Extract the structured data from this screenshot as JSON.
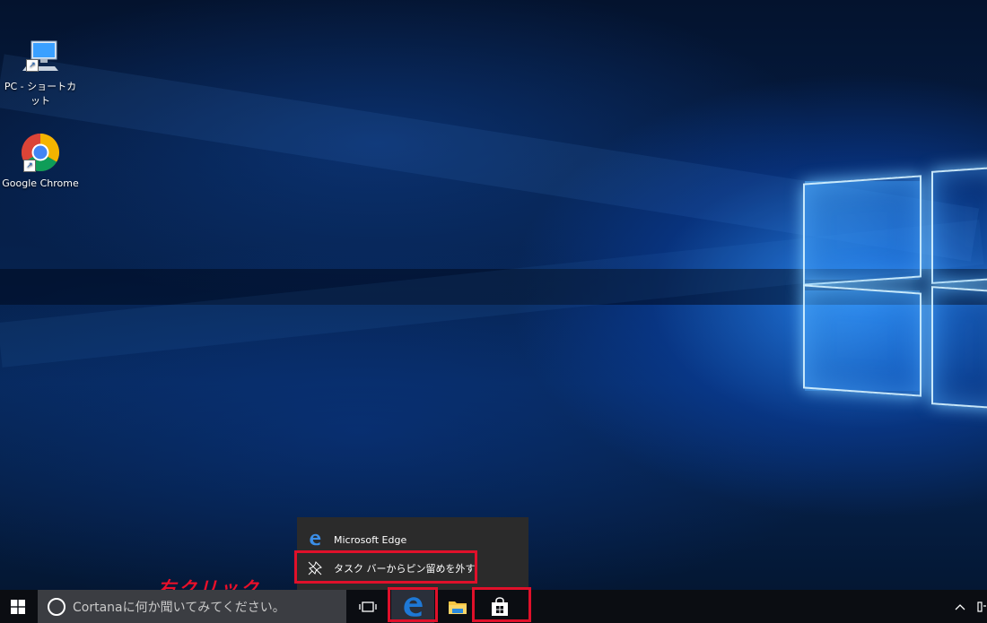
{
  "desktop": {
    "icons": [
      {
        "label": "PC - ショートカット",
        "icon": "pc-icon"
      },
      {
        "label": "Google Chrome",
        "icon": "chrome-icon"
      }
    ]
  },
  "jumplist": {
    "app_title": "Microsoft Edge",
    "unpin_label": "タスク バーからピン留めを外す"
  },
  "annotation": {
    "text": "右クリック",
    "color": "#e8102a"
  },
  "taskbar": {
    "search_placeholder": "Cortanaに何か聞いてみてください。",
    "pinned": [
      "task-view-icon",
      "edge-icon",
      "file-explorer-icon",
      "store-icon"
    ]
  },
  "colors": {
    "taskbar_bg": "#0b0d12",
    "search_bg": "#3b3d42",
    "highlight": "#e0102a",
    "edge_blue": "#1e78d6"
  }
}
